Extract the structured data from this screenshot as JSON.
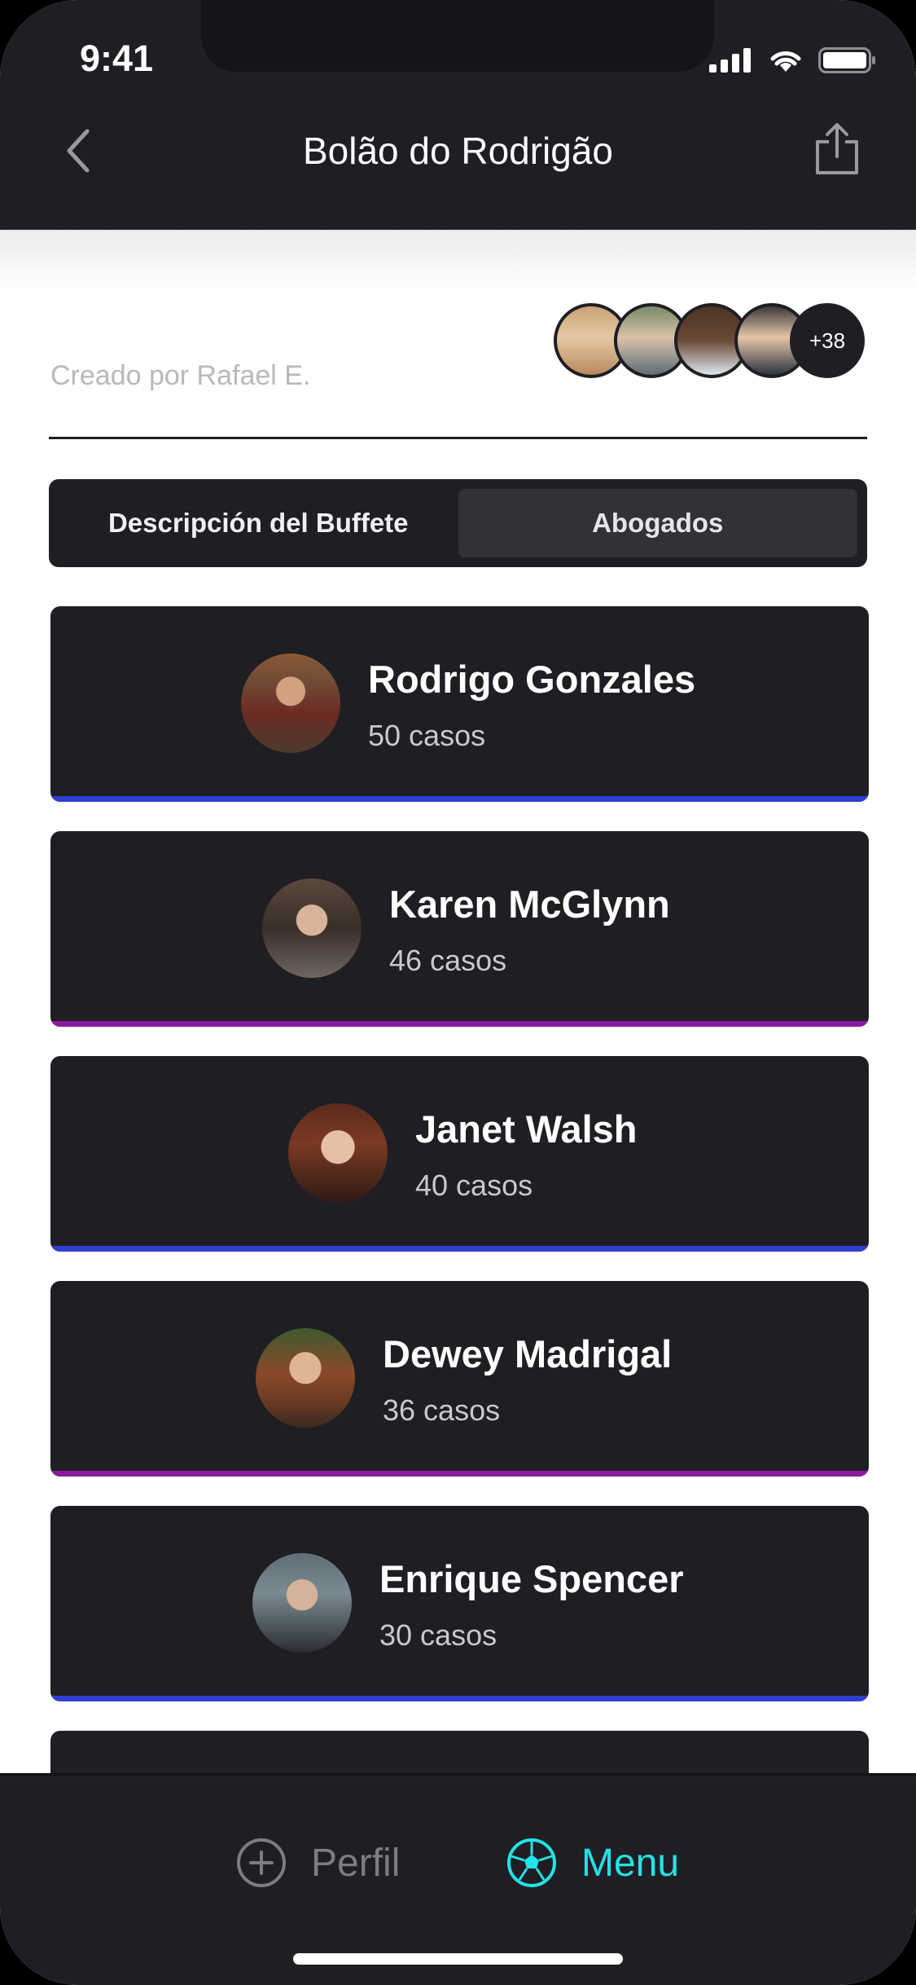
{
  "status": {
    "time": "9:41"
  },
  "header": {
    "title": "Bolão do Rodrigão"
  },
  "info": {
    "creator": "Creado por Rafael E.",
    "members_more": "+38"
  },
  "tabs": [
    {
      "label": "Descripción del Buffete",
      "active": false
    },
    {
      "label": "Abogados",
      "active": true
    }
  ],
  "lawyers": [
    {
      "name": "Rodrigo Gonzales",
      "cases": "50 casos",
      "accent": "#2f3fd1"
    },
    {
      "name": "Karen McGlynn",
      "cases": "46 casos",
      "accent": "#8a1aa0"
    },
    {
      "name": "Janet Walsh",
      "cases": "40 casos",
      "accent": "#2f3fd1"
    },
    {
      "name": "Dewey Madrigal",
      "cases": "36 casos",
      "accent": "#8a1aa0"
    },
    {
      "name": "Enrique Spencer",
      "cases": "30 casos",
      "accent": "#2f3fd1"
    }
  ],
  "tabbar": {
    "profile_label": "Perfil",
    "menu_label": "Menu",
    "active_color": "#21e3e8"
  }
}
